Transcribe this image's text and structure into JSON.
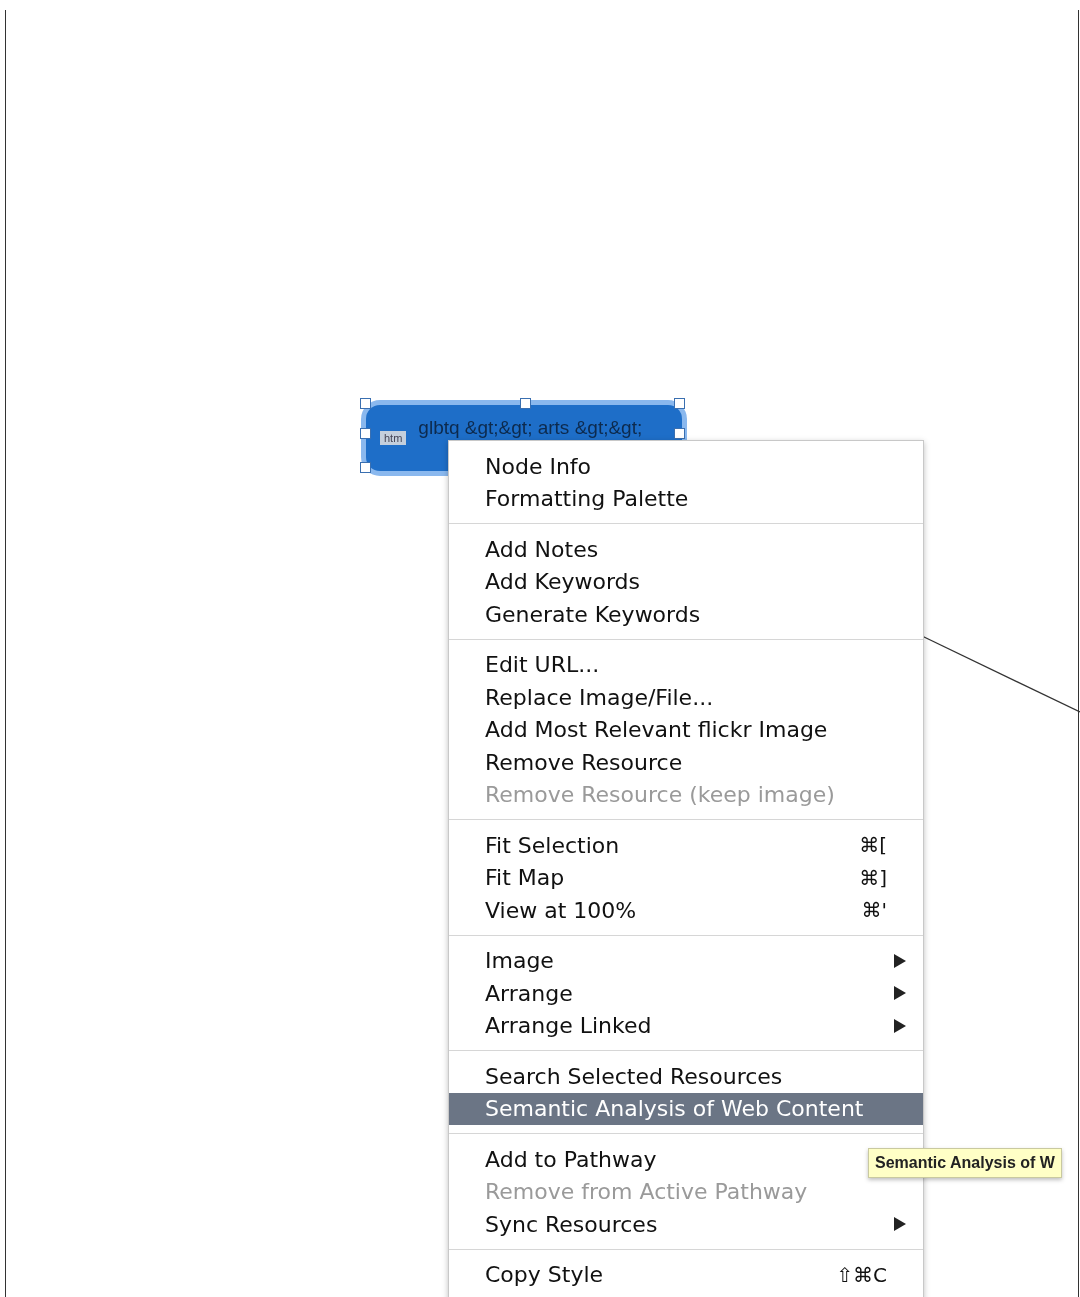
{
  "node": {
    "badge": "htm",
    "label": "glbtq &gt;&gt; arts &gt;&gt;",
    "selected": true
  },
  "context_menu": {
    "sections": [
      {
        "items": [
          {
            "label": "Node Info",
            "disabled": false,
            "selected": false
          },
          {
            "label": "Formatting Palette",
            "disabled": false,
            "selected": false
          }
        ]
      },
      {
        "items": [
          {
            "label": "Add Notes",
            "disabled": false,
            "selected": false
          },
          {
            "label": "Add Keywords",
            "disabled": false,
            "selected": false
          },
          {
            "label": "Generate Keywords",
            "disabled": false,
            "selected": false
          }
        ]
      },
      {
        "items": [
          {
            "label": "Edit URL...",
            "disabled": false,
            "selected": false
          },
          {
            "label": "Replace Image/File...",
            "disabled": false,
            "selected": false
          },
          {
            "label": "Add Most Relevant flickr Image",
            "disabled": false,
            "selected": false
          },
          {
            "label": "Remove Resource",
            "disabled": false,
            "selected": false
          },
          {
            "label": "Remove Resource (keep image)",
            "disabled": true,
            "selected": false
          }
        ]
      },
      {
        "items": [
          {
            "label": "Fit Selection",
            "shortcut": "⌘[",
            "disabled": false,
            "selected": false
          },
          {
            "label": "Fit Map",
            "shortcut": "⌘]",
            "disabled": false,
            "selected": false
          },
          {
            "label": "View at 100%",
            "shortcut": "⌘'",
            "disabled": false,
            "selected": false
          }
        ]
      },
      {
        "items": [
          {
            "label": "Image",
            "submenu": true,
            "disabled": false,
            "selected": false
          },
          {
            "label": "Arrange",
            "submenu": true,
            "disabled": false,
            "selected": false
          },
          {
            "label": "Arrange Linked",
            "submenu": true,
            "disabled": false,
            "selected": false
          }
        ]
      },
      {
        "items": [
          {
            "label": "Search Selected Resources",
            "disabled": false,
            "selected": false
          },
          {
            "label": "Semantic Analysis of Web Content",
            "disabled": false,
            "selected": true
          }
        ]
      },
      {
        "items": [
          {
            "label": "Add to Pathway",
            "disabled": false,
            "selected": false
          },
          {
            "label": "Remove from Active Pathway",
            "disabled": true,
            "selected": false
          },
          {
            "label": "Sync Resources",
            "submenu": true,
            "disabled": false,
            "selected": false
          }
        ]
      },
      {
        "items": [
          {
            "label": "Copy Style",
            "shortcut": "⇧⌘C",
            "disabled": false,
            "selected": false
          }
        ]
      }
    ]
  },
  "tooltip": {
    "text": "Semantic Analysis of W"
  }
}
